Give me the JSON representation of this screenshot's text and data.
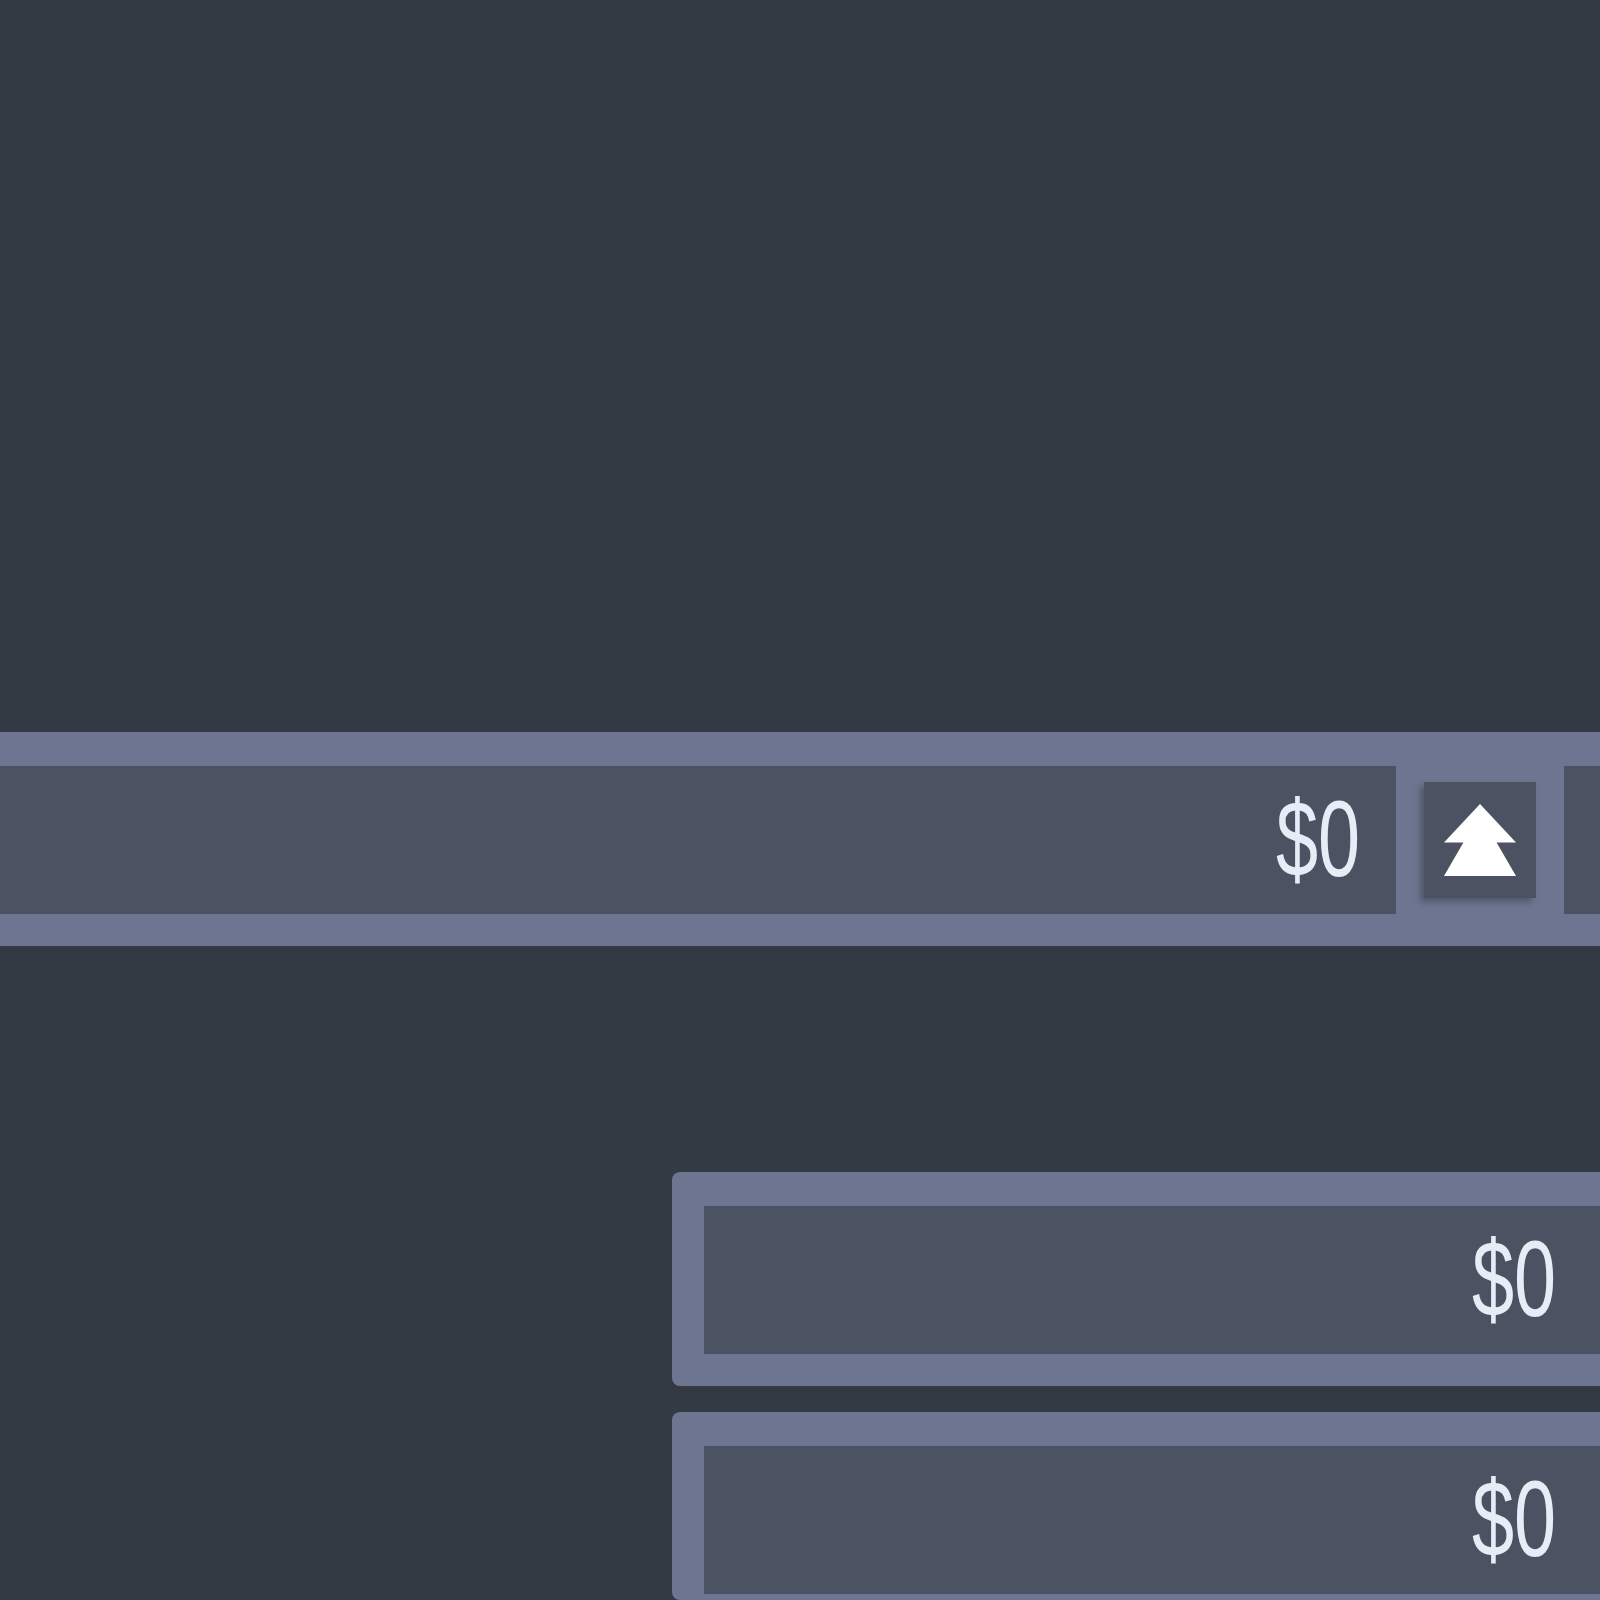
{
  "balance_bar": {
    "amount": "$0"
  },
  "cards": [
    {
      "amount": "$0"
    },
    {
      "amount": "$0"
    }
  ]
}
